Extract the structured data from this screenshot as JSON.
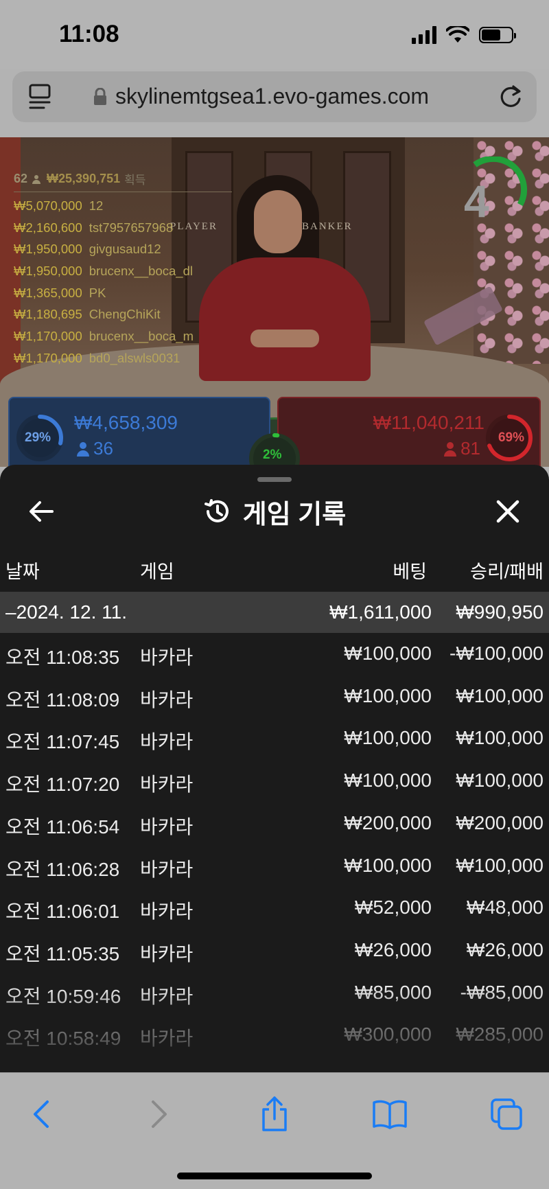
{
  "status": {
    "time": "11:08"
  },
  "browser": {
    "url": "skylinemtgsea1.evo-games.com"
  },
  "leaderboard": {
    "players": "62",
    "total": "₩25,390,751",
    "gain_label": "획득",
    "rows": [
      {
        "amount": "₩5,070,000",
        "name": "12"
      },
      {
        "amount": "₩2,160,600",
        "name": "tst7957657968"
      },
      {
        "amount": "₩1,950,000",
        "name": "givgusaud12"
      },
      {
        "amount": "₩1,950,000",
        "name": "brucenx__boca_dl"
      },
      {
        "amount": "₩1,365,000",
        "name": "PK"
      },
      {
        "amount": "₩1,180,695",
        "name": "ChengChiKit"
      },
      {
        "amount": "₩1,170,000",
        "name": "brucenx__boca_m"
      },
      {
        "amount": "₩1,170,000",
        "name": "bd0_alswls0031"
      }
    ]
  },
  "timer": {
    "value": "4"
  },
  "table_labels": {
    "player": "PLAYER",
    "banker": "BANKER"
  },
  "bets": {
    "player": {
      "percent": "29%",
      "percent_value": 0.29,
      "amount": "₩4,658,309",
      "count": "36",
      "color": "#3c7ad6"
    },
    "tie": {
      "percent": "2%",
      "percent_value": 0.02,
      "color": "#2fbf3a"
    },
    "banker": {
      "percent": "69%",
      "percent_value": 0.69,
      "amount": "₩11,040,211",
      "count": "81",
      "color": "#d2262c"
    }
  },
  "history": {
    "title": "게임 기록",
    "columns": {
      "date": "날짜",
      "game": "게임",
      "bet": "베팅",
      "result": "승리/패배"
    },
    "summary": {
      "date": "–2024. 12. 11.",
      "bet": "₩1,611,000",
      "result": "₩990,950"
    },
    "rows": [
      {
        "time": "오전 11:08:35",
        "game": "바카라",
        "bet": "₩100,000",
        "result": "-₩100,000"
      },
      {
        "time": "오전 11:08:09",
        "game": "바카라",
        "bet": "₩100,000",
        "result": "₩100,000"
      },
      {
        "time": "오전 11:07:45",
        "game": "바카라",
        "bet": "₩100,000",
        "result": "₩100,000"
      },
      {
        "time": "오전 11:07:20",
        "game": "바카라",
        "bet": "₩100,000",
        "result": "₩100,000"
      },
      {
        "time": "오전 11:06:54",
        "game": "바카라",
        "bet": "₩200,000",
        "result": "₩200,000"
      },
      {
        "time": "오전 11:06:28",
        "game": "바카라",
        "bet": "₩100,000",
        "result": "₩100,000"
      },
      {
        "time": "오전 11:06:01",
        "game": "바카라",
        "bet": "₩52,000",
        "result": "₩48,000"
      },
      {
        "time": "오전 11:05:35",
        "game": "바카라",
        "bet": "₩26,000",
        "result": "₩26,000"
      },
      {
        "time": "오전 10:59:46",
        "game": "바카라",
        "bet": "₩85,000",
        "result": "-₩85,000"
      },
      {
        "time": "오전 10:58:49",
        "game": "바카라",
        "bet": "₩300,000",
        "result": "₩285,000"
      }
    ]
  },
  "icons": {
    "back": "arrow-left-icon",
    "history": "history-clock-icon",
    "close": "close-icon",
    "nav_back": "chevron-left-icon",
    "nav_forward": "chevron-right-icon",
    "share": "share-icon",
    "bookmarks": "book-icon",
    "tabs": "tabs-icon"
  },
  "colors": {
    "accent_blue": "#1a7cf5",
    "sheet_bg": "#1b1b1b",
    "gold": "#c8b042"
  }
}
